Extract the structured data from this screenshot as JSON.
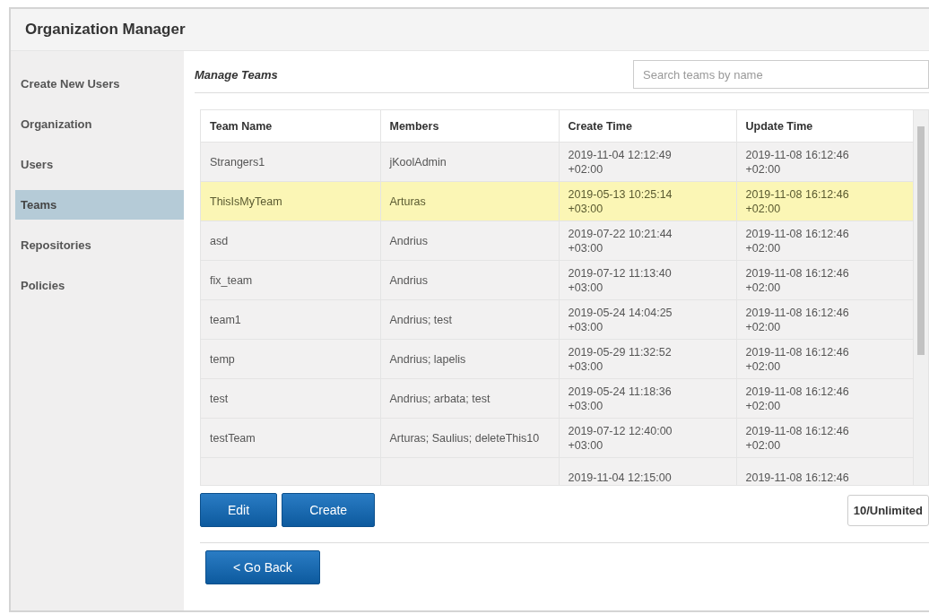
{
  "window": {
    "title": "Organization Manager"
  },
  "sidebar": {
    "items": [
      {
        "label": "Create New Users",
        "selected": false
      },
      {
        "label": "Organization",
        "selected": false
      },
      {
        "label": "Users",
        "selected": false
      },
      {
        "label": "Teams",
        "selected": true
      },
      {
        "label": "Repositories",
        "selected": false
      },
      {
        "label": "Policies",
        "selected": false
      }
    ]
  },
  "section_title": "Manage Teams",
  "search": {
    "placeholder": "Search teams by name"
  },
  "table": {
    "columns": [
      "Team Name",
      "Members",
      "Create Time",
      "Update Time"
    ],
    "rows": [
      {
        "name": "Strangers1",
        "members": "jKoolAdmin",
        "create_time": "2019-11-04 12:12:49 +02:00",
        "update_time": "2019-11-08 16:12:46 +02:00",
        "selected": false
      },
      {
        "name": "ThisIsMyTeam",
        "members": "Arturas",
        "create_time": "2019-05-13 10:25:14 +03:00",
        "update_time": "2019-11-08 16:12:46 +02:00",
        "selected": true
      },
      {
        "name": "asd",
        "members": "Andrius",
        "create_time": "2019-07-22 10:21:44 +03:00",
        "update_time": "2019-11-08 16:12:46 +02:00",
        "selected": false
      },
      {
        "name": "fix_team",
        "members": "Andrius",
        "create_time": "2019-07-12 11:13:40 +03:00",
        "update_time": "2019-11-08 16:12:46 +02:00",
        "selected": false
      },
      {
        "name": "team1",
        "members": "Andrius; test",
        "create_time": "2019-05-24 14:04:25 +03:00",
        "update_time": "2019-11-08 16:12:46 +02:00",
        "selected": false
      },
      {
        "name": "temp",
        "members": "Andrius; lapelis",
        "create_time": "2019-05-29 11:32:52 +03:00",
        "update_time": "2019-11-08 16:12:46 +02:00",
        "selected": false
      },
      {
        "name": "test",
        "members": "Andrius; arbata; test",
        "create_time": "2019-05-24 11:18:36 +03:00",
        "update_time": "2019-11-08 16:12:46 +02:00",
        "selected": false
      },
      {
        "name": "testTeam",
        "members": "Arturas; Saulius; deleteThis10",
        "create_time": "2019-07-12 12:40:00 +03:00",
        "update_time": "2019-11-08 16:12:46 +02:00",
        "selected": false
      },
      {
        "create_time": "2019-11-04 12:15:00",
        "update_time": "2019-11-08 16:12:46",
        "selected": false
      }
    ]
  },
  "buttons": [
    "Edit",
    "Create"
  ],
  "count": "10/Unlimited",
  "back_button": "< Go Back"
}
